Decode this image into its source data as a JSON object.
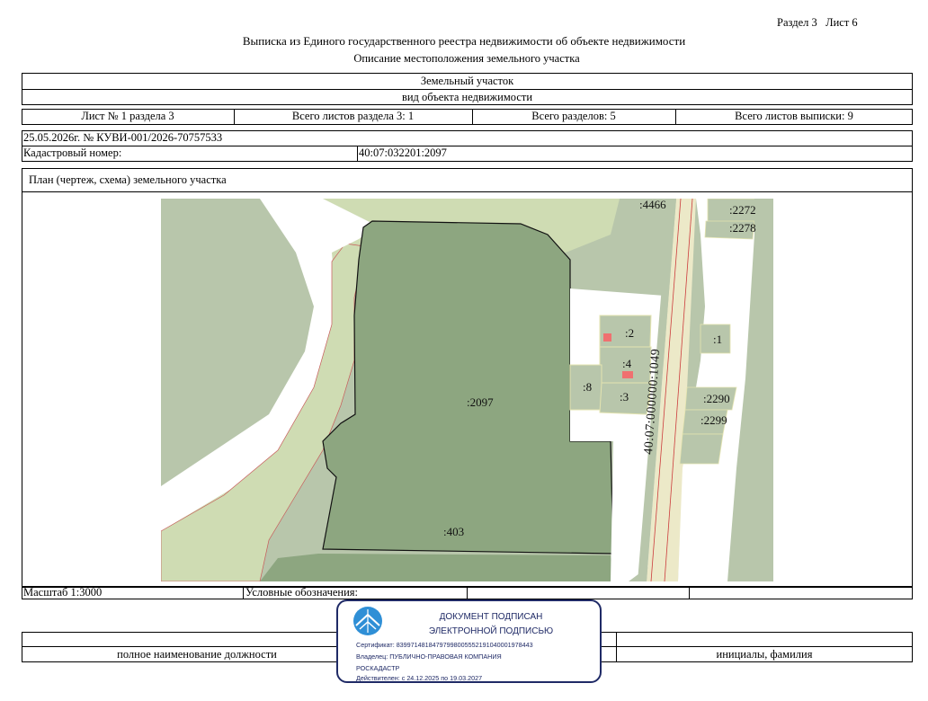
{
  "header": {
    "section_sheet": "Раздел 3   Лист 6",
    "title": "Выписка из Единого государственного реестра недвижимости об объекте недвижимости",
    "subtitle": "Описание местоположения земельного участка"
  },
  "object": {
    "type": "Земельный участок",
    "type_caption": "вид объекта недвижимости"
  },
  "sheet_info": {
    "sheet": "Лист № 1 раздела 3",
    "total_sheets_section": "Всего листов раздела 3: 1",
    "total_sections": "Всего разделов: 5",
    "total_sheets_extract": "Всего листов выписки: 9"
  },
  "document": {
    "date_number": "25.05.2026г. № КУВИ-001/2026-70757533",
    "cadastral_label": "Кадастровый номер:",
    "cadastral_number": "40:07:032201:2097"
  },
  "plan": {
    "heading": "План (чертеж, схема) земельного участка",
    "labels": {
      "main": ":2097",
      "l403": ":403",
      "l4466": ":4466",
      "l2272": ":2272",
      "l2278": ":2278",
      "l2": ":2",
      "l1": ":1",
      "l4": ":4",
      "l8": ":8",
      "l3": ":3",
      "l2290": ":2290",
      "l2299": ":2299",
      "road": "40:07:000000:1049"
    },
    "colors": {
      "parcel_main": "#8da680",
      "background_green": "#b8c6ab",
      "light_green": "#cfdcb3",
      "road_cream": "#ece9c8",
      "boundary_red": "#cc3c3c",
      "building_red": "#f07070"
    }
  },
  "footer": {
    "scale": "Масштаб 1:3000",
    "legend": "Условные обозначения:",
    "position_caption": "полное наименование должности",
    "initials_caption": "инициалы, фамилия"
  },
  "signature": {
    "line1": "ДОКУМЕНТ ПОДПИСАН",
    "line2": "ЭЛЕКТРОННОЙ ПОДПИСЬЮ",
    "certificate": "Сертификат: 839971481847979980055521910400019784​43",
    "owner": "Владелец: ПУБЛИЧНО-ПРАВОВАЯ КОМПАНИЯ",
    "owner2": "РОСКАДАСТР",
    "valid": "Действителен: с 24.12.2025 по 19.03.2027"
  }
}
